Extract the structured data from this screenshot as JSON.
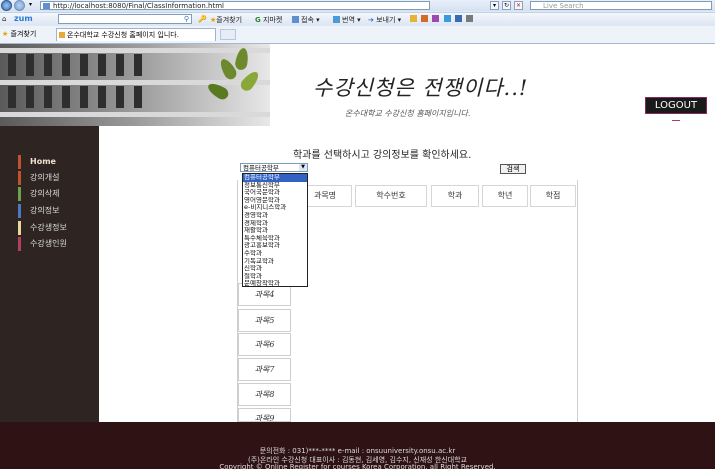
{
  "browser": {
    "url": "http://localhost:8080/Final/ClassInformation.html",
    "live_search_placeholder": "Live Search",
    "logo": "zum",
    "toolbar": [
      "즐겨찾기",
      "지마켓",
      "접속",
      "번역",
      "보내기"
    ],
    "favorites_label": "즐겨찾기",
    "tab_title": "온수대학교 수강신청 홈페이지 입니다."
  },
  "banner": {
    "title": "수강신청은 전쟁이다..!",
    "subtitle": "온수대학교 수강신청 홈페이지입니다.",
    "logout": "LOGOUT"
  },
  "sidebar": {
    "items": [
      {
        "label": "Home",
        "color": "#c0522f"
      },
      {
        "label": "강의개설",
        "color": "#c0522f"
      },
      {
        "label": "강의삭제",
        "color": "#6aa34a"
      },
      {
        "label": "강의정보",
        "color": "#4b78c0"
      },
      {
        "label": "수강생정보",
        "color": "#e8d8a0"
      },
      {
        "label": "수강생인원",
        "color": "#b04060"
      }
    ]
  },
  "main": {
    "heading": "학과를 선택하시고 강의정보를 확인하세요.",
    "department_select": "컴퓨터공학부",
    "search_button": "검색",
    "columns": [
      "과목명",
      "학수번호",
      "학과",
      "학년",
      "학점"
    ],
    "dropdown_options": [
      "컴퓨터공학부",
      "정보통신학부",
      "국어국문학과",
      "영어영문학과",
      "e-비지니스학과",
      "경영학과",
      "경제학과",
      "재활학과",
      "특수체육학과",
      "광고홍보학과",
      "수학과",
      "기독교학과",
      "신학과",
      "철학과",
      "문예창작학과"
    ],
    "subjects": [
      "과목4",
      "과목5",
      "과목6",
      "과목7",
      "과목8",
      "과목9"
    ]
  },
  "footer": {
    "contact": "문의전화 : 031)***-****    e-mail : onsuuniversity.onsu.ac.kr",
    "representatives": "(주)온라인 수강신청 대표이사 : 김동현, 김세영, 김수지, 신재성 한신대학교",
    "copyright": "Copyright © Online Register for courses Korea Corporation. all Right Reserved."
  }
}
